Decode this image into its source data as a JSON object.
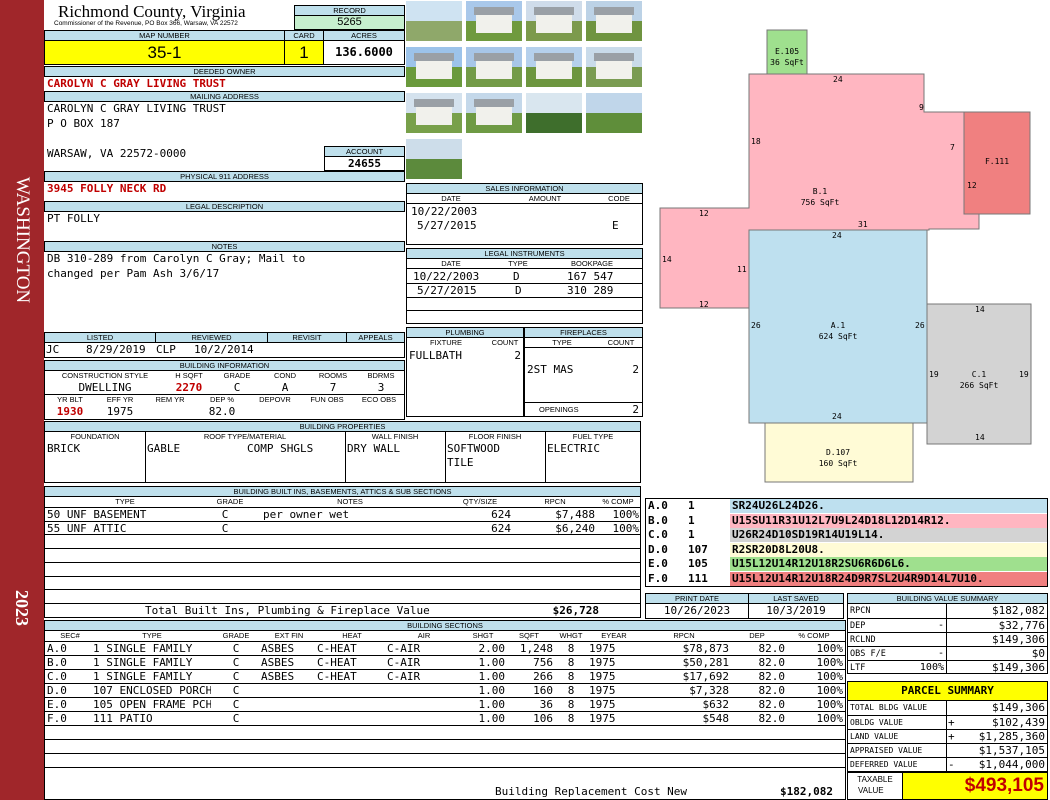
{
  "side_banner": {
    "district": "WASHINGTON",
    "year": "2023"
  },
  "header": {
    "county": "Richmond County, Virginia",
    "commissioner": "Commissioner of the Revenue, PO Box 366, Warsaw, VA 22572"
  },
  "record": {
    "label": "RECORD",
    "value": "5265"
  },
  "map": {
    "label": "MAP NUMBER",
    "value": "35-1"
  },
  "card": {
    "label": "CARD",
    "value": "1"
  },
  "acres": {
    "label": "ACRES",
    "value": "136.6000"
  },
  "owner": {
    "label": "DEEDED OWNER",
    "value": "CAROLYN C GRAY LIVING TRUST"
  },
  "mailing": {
    "label": "MAILING ADDRESS",
    "line1": "CAROLYN C GRAY LIVING TRUST",
    "line2": "P O BOX 187",
    "line3": "WARSAW, VA 22572-0000"
  },
  "account": {
    "label": "ACCOUNT",
    "value": "24655"
  },
  "physical": {
    "label": "PHYSICAL 911 ADDRESS",
    "value": "3945 FOLLY NECK RD"
  },
  "legal": {
    "label": "LEGAL DESCRIPTION",
    "value": "PT FOLLY"
  },
  "notes": {
    "label": "NOTES",
    "line1": "DB 310-289 from Carolyn C Gray; Mail to",
    "line2": "changed per Pam Ash 3/6/17"
  },
  "sales": {
    "label": "SALES INFORMATION",
    "cols": [
      "DATE",
      "AMOUNT",
      "CODE"
    ],
    "rows": [
      [
        "10/22/2003",
        "",
        ""
      ],
      [
        "5/27/2015",
        "",
        "E"
      ]
    ]
  },
  "instruments": {
    "label": "LEGAL INSTRUMENTS",
    "cols": [
      "DATE",
      "TYPE",
      "BOOKPAGE"
    ],
    "rows": [
      [
        "10/22/2003",
        "D",
        "167 547"
      ],
      [
        "5/27/2015",
        "D",
        "310 289"
      ]
    ]
  },
  "status": {
    "listed_label": "LISTED",
    "reviewed_label": "REVIEWED",
    "revisit_label": "REVISIT",
    "appeals_label": "APPEALS",
    "listed_by": "JC",
    "listed_date": "8/29/2019",
    "reviewed_by": "CLP",
    "reviewed_date": "10/2/2014"
  },
  "building_info": {
    "label": "BUILDING INFORMATION",
    "cols1": [
      "CONSTRUCTION STYLE",
      "H SQFT",
      "GRADE",
      "COND",
      "ROOMS",
      "BDRMS"
    ],
    "vals1": [
      "DWELLING",
      "2270",
      "C",
      "A",
      "7",
      "3"
    ],
    "cols2": [
      "YR BLT",
      "EFF YR",
      "REM YR",
      "DEP %",
      "DEPOVR",
      "FUN OBS",
      "ECO OBS"
    ],
    "vals2": [
      "1930",
      "1975",
      "",
      "82.0",
      "",
      "",
      ""
    ]
  },
  "plumbing": {
    "label": "PLUMBING",
    "fixture_label": "FIXTURE",
    "count_label": "COUNT",
    "fixture": "FULLBATH",
    "count": "2"
  },
  "fireplaces": {
    "label": "FIREPLACES",
    "type_label": "TYPE",
    "count_label": "COUNT",
    "type": "2ST MAS",
    "count": "2",
    "openings_label": "OPENINGS",
    "openings": "2"
  },
  "properties": {
    "label": "BUILDING PROPERTIES",
    "foundation_label": "FOUNDATION",
    "roof_label": "ROOF TYPE/MATERIAL",
    "wall_label": "WALL FINISH",
    "floor_label": "FLOOR FINISH",
    "fuel_label": "FUEL TYPE",
    "foundation": "BRICK",
    "roof_type": "GABLE",
    "roof_material": "COMP SHGLS",
    "wall": "DRY WALL",
    "floor1": "SOFTWOOD",
    "floor2": "TILE",
    "fuel": "ELECTRIC"
  },
  "builtins": {
    "label": "BUILDING BUILT INS, BASEMENTS, ATTICS & SUB SECTIONS",
    "cols": [
      "TYPE",
      "GRADE",
      "NOTES",
      "QTY/SIZE",
      "RPCN",
      "% COMP"
    ],
    "rows": [
      [
        "50 UNF BASEMENT",
        "C",
        "per owner wet",
        "624",
        "$7,488",
        "100%"
      ],
      [
        "55 UNF ATTIC",
        "C",
        "",
        "624",
        "$6,240",
        "100%"
      ]
    ],
    "total_label": "Total Built Ins, Plumbing & Fireplace Value",
    "total": "$26,728"
  },
  "sketch_codes": [
    {
      "sec": "A.0",
      "code": "1",
      "path": "SR24U26L24D26.",
      "color": "#bee0ef"
    },
    {
      "sec": "B.0",
      "code": "1",
      "path": "U15SU11R31U12L7U9L24D18L12D14R12.",
      "color": "#ffb6c1"
    },
    {
      "sec": "C.0",
      "code": "1",
      "path": "U26R24D10SD19R14U19L14.",
      "color": "#d3d3d3"
    },
    {
      "sec": "D.0",
      "code": "107",
      "path": "R2SR20D8L20U8.",
      "color": "#fffbd6"
    },
    {
      "sec": "E.0",
      "code": "105",
      "path": "U15L12U14R12U18R2SU6R6D6L6.",
      "color": "#9fe08e"
    },
    {
      "sec": "F.0",
      "code": "111",
      "path": "U15L12U14R12U18R24D9R7SL2U4R9D14L7U10.",
      "color": "#f08080"
    }
  ],
  "sketch": {
    "A": {
      "label": "A.1",
      "area": "624 SqFt"
    },
    "B": {
      "label": "B.1",
      "area": "756 SqFt"
    },
    "C": {
      "label": "C.1",
      "area": "266 SqFt"
    },
    "D": {
      "label": "D.107",
      "area": "160 SqFt"
    },
    "E": {
      "label": "E.105",
      "area": "36 SqFt"
    },
    "F": {
      "label": "F.111"
    },
    "dims": {
      "b_top": "24",
      "b_9": "9",
      "b_7": "7",
      "b_18": "18",
      "b_12r": "12",
      "b_12a": "12",
      "b_14": "14",
      "b_11": "11",
      "b_12b": "12",
      "b_31": "31",
      "a_top": "24",
      "a_left": "26",
      "a_right": "26",
      "a_bot": "24",
      "c_top": "14",
      "c_left": "19",
      "c_right": "19",
      "c_bot": "14"
    }
  },
  "dates": {
    "print_label": "PRINT DATE",
    "print": "10/26/2023",
    "saved_label": "LAST SAVED",
    "saved": "10/3/2019"
  },
  "bldg_summary": {
    "label": "BUILDING VALUE SUMMARY",
    "rows": [
      [
        "RPCN",
        "",
        "$182,082"
      ],
      [
        "DEP",
        "-",
        "$32,776"
      ],
      [
        "RCLND",
        "",
        "$149,306"
      ],
      [
        "OBS F/E",
        "-",
        "$0"
      ],
      [
        "LTF",
        "100%",
        "$149,306"
      ]
    ]
  },
  "parcel_summary": {
    "label": "PARCEL SUMMARY",
    "rows": [
      [
        "TOTAL BLDG VALUE",
        "",
        "$149,306"
      ],
      [
        "OBLDG VALUE",
        "+",
        "$102,439"
      ],
      [
        "LAND VALUE",
        "+",
        "$1,285,360"
      ],
      [
        "APPRAISED VALUE",
        "",
        "$1,537,105"
      ],
      [
        "DEFERRED VALUE",
        "-",
        "$1,044,000"
      ]
    ],
    "taxable_label1": "TAXABLE",
    "taxable_label2": "VALUE",
    "taxable": "$493,105"
  },
  "sections": {
    "label": "BUILDING SECTIONS",
    "cols": [
      "SEC#",
      "TYPE",
      "GRADE",
      "EXT FIN",
      "HEAT",
      "AIR",
      "SHGT",
      "SQFT",
      "WHGT",
      "EYEAR",
      "RPCN",
      "DEP",
      "% COMP"
    ],
    "rows": [
      [
        "A.0",
        "1 SINGLE FAMILY",
        "C",
        "ASBES",
        "C-HEAT",
        "C-AIR",
        "2.00",
        "1,248",
        "8",
        "1975",
        "$78,873",
        "82.0",
        "100%"
      ],
      [
        "B.0",
        "1 SINGLE FAMILY",
        "C",
        "ASBES",
        "C-HEAT",
        "C-AIR",
        "1.00",
        "756",
        "8",
        "1975",
        "$50,281",
        "82.0",
        "100%"
      ],
      [
        "C.0",
        "1 SINGLE FAMILY",
        "C",
        "ASBES",
        "C-HEAT",
        "C-AIR",
        "1.00",
        "266",
        "8",
        "1975",
        "$17,692",
        "82.0",
        "100%"
      ],
      [
        "D.0",
        "107 ENCLOSED PORCH",
        "C",
        "",
        "",
        "",
        "1.00",
        "160",
        "8",
        "1975",
        "$7,328",
        "82.0",
        "100%"
      ],
      [
        "E.0",
        "105 OPEN FRAME PCH",
        "C",
        "",
        "",
        "",
        "1.00",
        "36",
        "8",
        "1975",
        "$632",
        "82.0",
        "100%"
      ],
      [
        "F.0",
        "111 PATIO",
        "C",
        "",
        "",
        "",
        "1.00",
        "106",
        "8",
        "1975",
        "$548",
        "82.0",
        "100%"
      ]
    ],
    "total_label": "Building Replacement Cost New",
    "total": "$182,082"
  },
  "photos": [
    {
      "name": "photo-waterfront",
      "sky": "#cfe3f2",
      "gnd": "#8fa86a"
    },
    {
      "name": "photo-metal-barn",
      "sky": "#a9c8ea",
      "gnd": "#6f9a3e"
    },
    {
      "name": "photo-gambrel-barn",
      "sky": "#cfdcea",
      "gnd": "#7c9a4c"
    },
    {
      "name": "photo-shed",
      "sky": "#bcd2e6",
      "gnd": "#6f9440"
    },
    {
      "name": "photo-house",
      "sky": "#9cc3ea",
      "gnd": "#6a9a3c"
    },
    {
      "name": "photo-metal-shed",
      "sky": "#a7c6e8",
      "gnd": "#739b48"
    },
    {
      "name": "photo-pole-barn",
      "sky": "#b5d0ec",
      "gnd": "#6d963f"
    },
    {
      "name": "photo-round-barn",
      "sky": "#c9dbea",
      "gnd": "#7a9c52"
    },
    {
      "name": "photo-cottage",
      "sky": "#d4e2ee",
      "gnd": "#78a04a"
    },
    {
      "name": "photo-small-house",
      "sky": "#c4d8ea",
      "gnd": "#6e9a44"
    },
    {
      "name": "photo-trees",
      "sky": "#d9e6ef",
      "gnd": "#3e6e2c"
    },
    {
      "name": "photo-field",
      "sky": "#c0d6ea",
      "gnd": "#5f8e3a"
    },
    {
      "name": "photo-marsh",
      "sky": "#cdddea",
      "gnd": "#5c8a3c"
    }
  ]
}
